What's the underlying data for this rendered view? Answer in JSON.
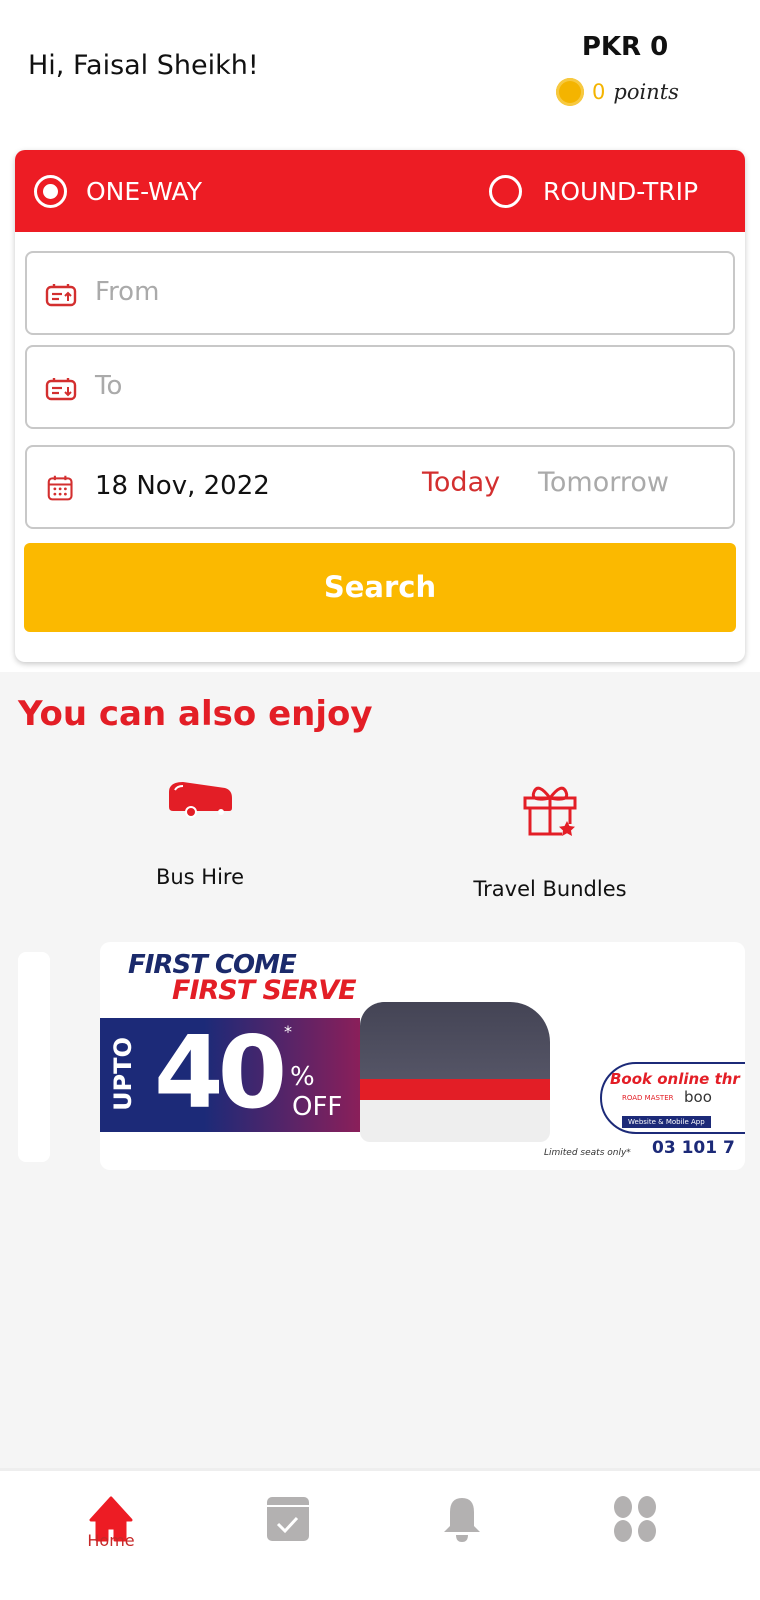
{
  "header": {
    "greeting": "Hi, Faisal Sheikh!",
    "balance": "PKR 0",
    "points_value": "0",
    "points_label": "points"
  },
  "search_card": {
    "trip_types": [
      {
        "label": "ONE-WAY",
        "selected": true
      },
      {
        "label": "ROUND-TRIP",
        "selected": false
      }
    ],
    "from": {
      "placeholder": "From",
      "value": ""
    },
    "to": {
      "placeholder": "To",
      "value": ""
    },
    "date": {
      "value": "18 Nov, 2022",
      "today": "Today",
      "tomorrow": "Tomorrow"
    },
    "search_label": "Search"
  },
  "enjoy": {
    "title": "You can also enjoy",
    "items": [
      {
        "label": "Bus Hire",
        "icon": "bus-icon"
      },
      {
        "label": "Travel Bundles",
        "icon": "gift-icon"
      }
    ]
  },
  "banner": {
    "line1": "FIRST COME",
    "line2": "FIRST SERVE",
    "upto": "UPTO",
    "percent": "40",
    "pct_sign": "%",
    "off": "OFF",
    "asterisk": "*",
    "book": "Book online thr",
    "brand": "ROAD MASTER",
    "partner": "boo",
    "web": "Website & Mobile App",
    "limited": "Limited seats only*",
    "phone": "03 101 7"
  },
  "bottom_nav": [
    {
      "label": "Home",
      "icon": "home-icon",
      "active": true
    },
    {
      "icon": "bookings-icon"
    },
    {
      "icon": "bell-icon"
    },
    {
      "icon": "menu-grid-icon"
    }
  ],
  "colors": {
    "brand_red": "#ED1C24",
    "search_yellow": "#FBB900",
    "inactive": "#B3B1B1"
  }
}
